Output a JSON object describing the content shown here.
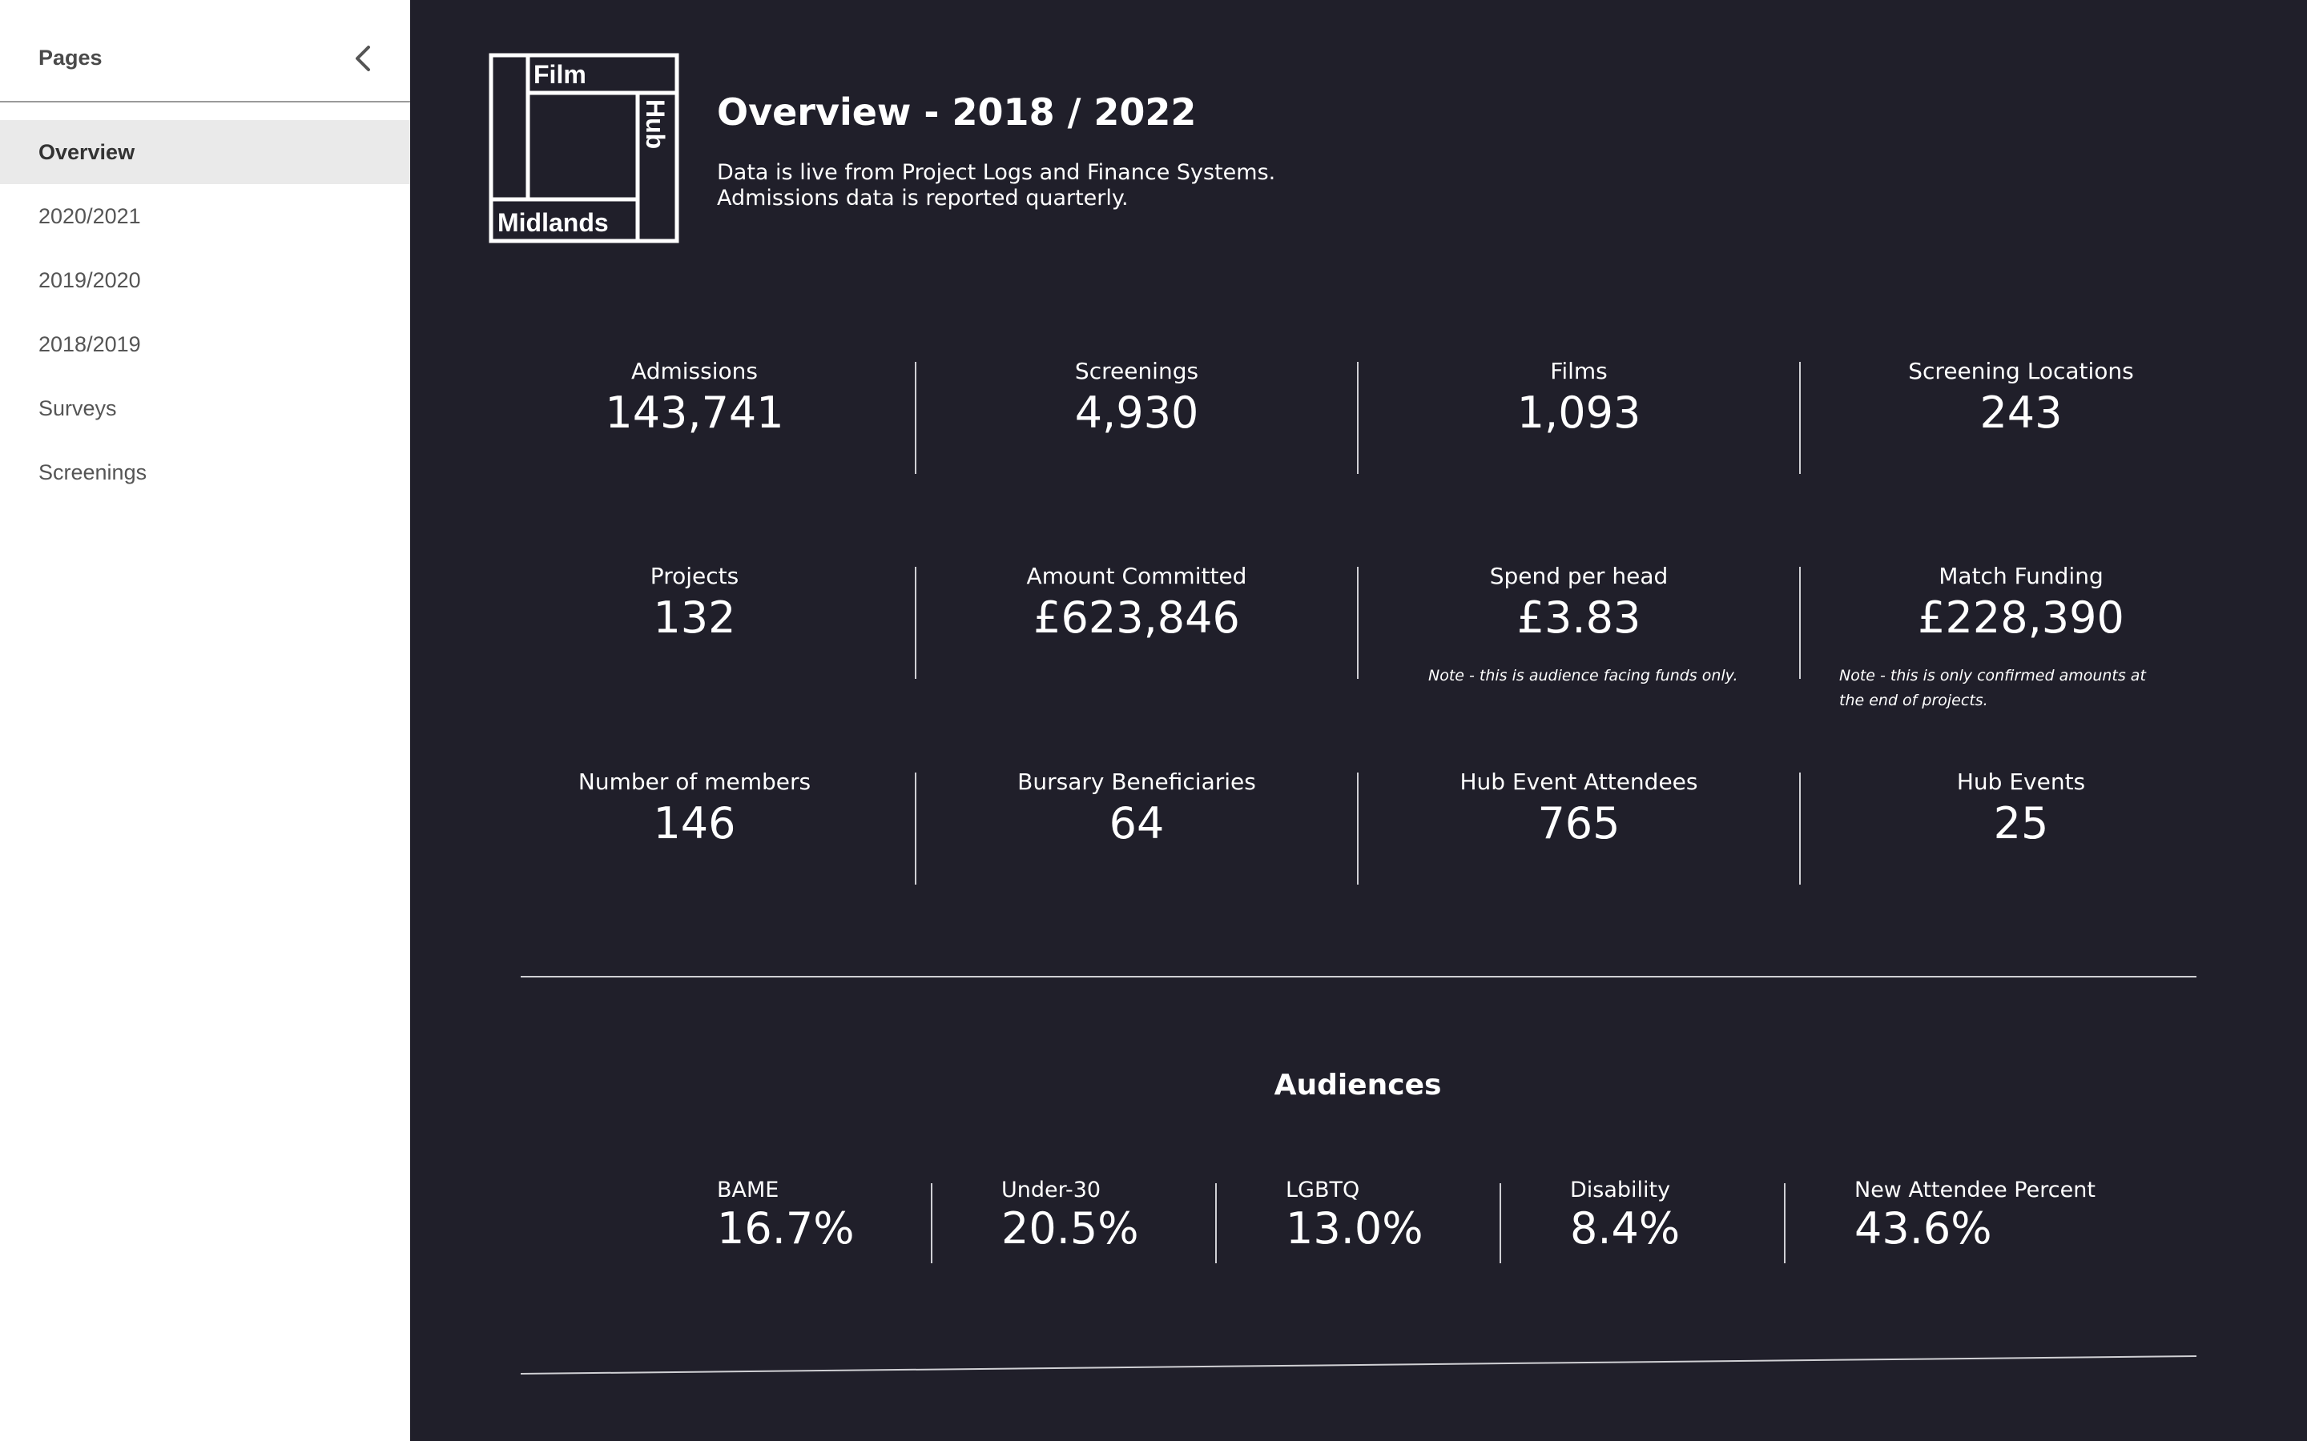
{
  "sidebar": {
    "title": "Pages",
    "items": [
      {
        "label": "Overview",
        "active": true
      },
      {
        "label": "2020/2021"
      },
      {
        "label": "2019/2020"
      },
      {
        "label": "2018/2019"
      },
      {
        "label": "Surveys"
      },
      {
        "label": "Screenings"
      }
    ]
  },
  "logo": {
    "top": "Film",
    "side": "Hub",
    "bottom": "Midlands"
  },
  "header": {
    "title": "Overview - 2018 / 2022",
    "subtitle_line1": "Data is live from Project Logs and Finance Systems.",
    "subtitle_line2": "Admissions data is reported quarterly."
  },
  "kpis": [
    {
      "label": "Admissions",
      "value": "143,741"
    },
    {
      "label": "Screenings",
      "value": "4,930"
    },
    {
      "label": "Films",
      "value": "1,093"
    },
    {
      "label": "Screening Locations",
      "value": "243"
    },
    {
      "label": "Projects",
      "value": "132"
    },
    {
      "label": "Amount Committed",
      "value": "£623,846"
    },
    {
      "label": "Spend per head",
      "value": "£3.83",
      "note": "Note - this is audience facing funds only."
    },
    {
      "label": "Match Funding",
      "value": "£228,390",
      "note_line1": "Note - this is only confirmed amounts at",
      "note_line2": "the end of projects."
    },
    {
      "label": "Number of members",
      "value": "146"
    },
    {
      "label": "Bursary Beneficiaries",
      "value": "64"
    },
    {
      "label": "Hub Event Attendees",
      "value": "765"
    },
    {
      "label": "Hub Events",
      "value": "25"
    }
  ],
  "audiences": {
    "title": "Audiences",
    "items": [
      {
        "label": "BAME",
        "value": "16.7%"
      },
      {
        "label": "Under-30",
        "value": "20.5%"
      },
      {
        "label": "LGBTQ",
        "value": "13.0%"
      },
      {
        "label": "Disability",
        "value": "8.4%"
      },
      {
        "label": "New Attendee Percent",
        "value": "43.6%"
      }
    ]
  },
  "colors": {
    "background": "#201f2a",
    "sidebar": "#ffffff",
    "active_item": "#eaeaea",
    "text": "#ffffff"
  },
  "icons": {
    "collapse": "chevron-left-icon"
  }
}
